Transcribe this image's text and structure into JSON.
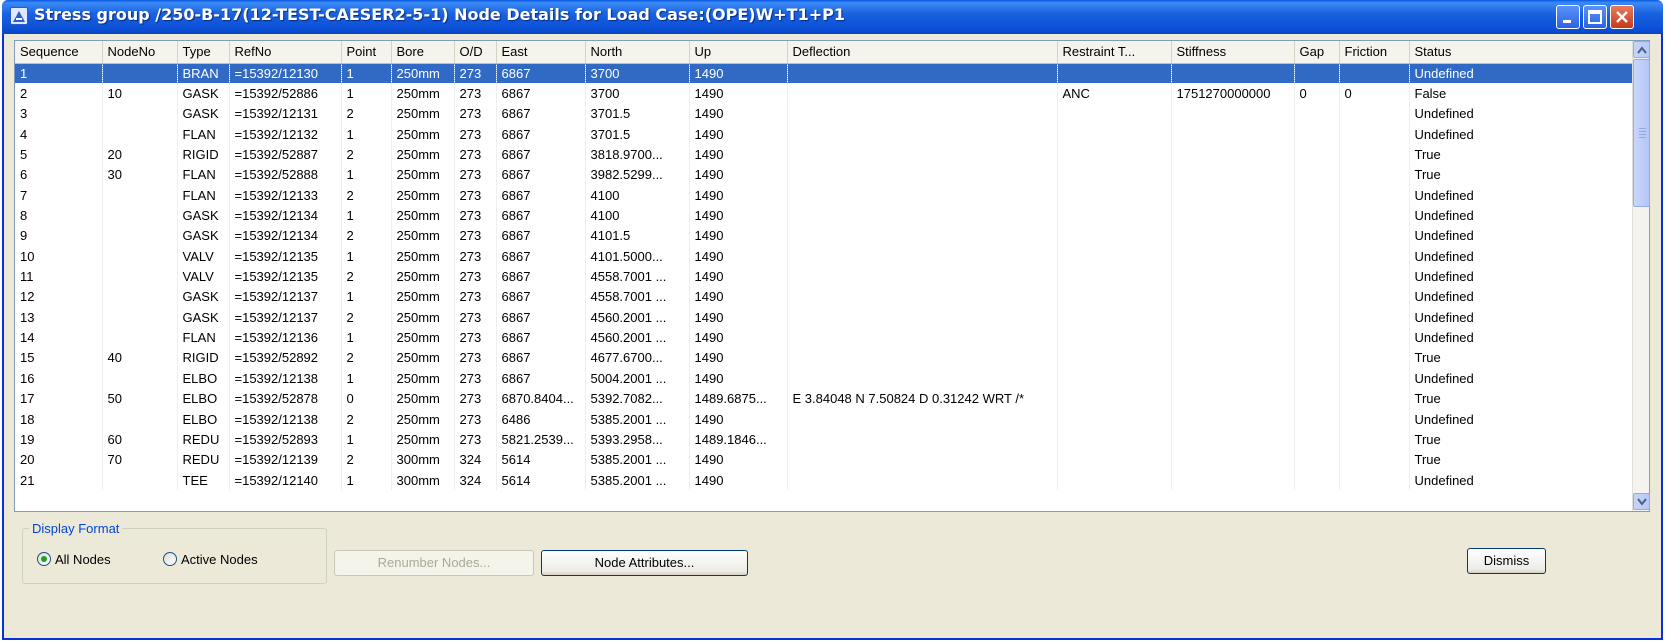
{
  "window": {
    "title": "Stress group /250-B-17(12-TEST-CAESER2-5-1) Node Details for Load Case:(OPE)W+T1+P1"
  },
  "grid": {
    "columns": [
      "Sequence",
      "NodeNo",
      "Type",
      "RefNo",
      "Point",
      "Bore",
      "O/D",
      "East",
      "North",
      "Up",
      "Deflection",
      "Restraint T...",
      "Stiffness",
      "Gap",
      "Friction",
      "Status"
    ],
    "rows": [
      [
        "1",
        "",
        "BRAN",
        "=15392/12130",
        "1",
        "250mm",
        "273",
        "6867",
        "3700",
        "1490",
        "",
        "",
        "",
        "",
        "",
        "Undefined"
      ],
      [
        "2",
        "10",
        "GASK",
        "=15392/52886",
        "1",
        "250mm",
        "273",
        "6867",
        "3700",
        "1490",
        "",
        "ANC",
        "1751270000000",
        "0",
        "0",
        "False"
      ],
      [
        "3",
        "",
        "GASK",
        "=15392/12131",
        "2",
        "250mm",
        "273",
        "6867",
        "3701.5",
        "1490",
        "",
        "",
        "",
        "",
        "",
        "Undefined"
      ],
      [
        "4",
        "",
        "FLAN",
        "=15392/12132",
        "1",
        "250mm",
        "273",
        "6867",
        "3701.5",
        "1490",
        "",
        "",
        "",
        "",
        "",
        "Undefined"
      ],
      [
        "5",
        "20",
        "RIGID",
        "=15392/52887",
        "2",
        "250mm",
        "273",
        "6867",
        "3818.9700...",
        "1490",
        "",
        "",
        "",
        "",
        "",
        "True"
      ],
      [
        "6",
        "30",
        "FLAN",
        "=15392/52888",
        "1",
        "250mm",
        "273",
        "6867",
        "3982.5299...",
        "1490",
        "",
        "",
        "",
        "",
        "",
        "True"
      ],
      [
        "7",
        "",
        "FLAN",
        "=15392/12133",
        "2",
        "250mm",
        "273",
        "6867",
        "4100",
        "1490",
        "",
        "",
        "",
        "",
        "",
        "Undefined"
      ],
      [
        "8",
        "",
        "GASK",
        "=15392/12134",
        "1",
        "250mm",
        "273",
        "6867",
        "4100",
        "1490",
        "",
        "",
        "",
        "",
        "",
        "Undefined"
      ],
      [
        "9",
        "",
        "GASK",
        "=15392/12134",
        "2",
        "250mm",
        "273",
        "6867",
        "4101.5",
        "1490",
        "",
        "",
        "",
        "",
        "",
        "Undefined"
      ],
      [
        "10",
        "",
        "VALV",
        "=15392/12135",
        "1",
        "250mm",
        "273",
        "6867",
        "4101.5000...",
        "1490",
        "",
        "",
        "",
        "",
        "",
        "Undefined"
      ],
      [
        "11",
        "",
        "VALV",
        "=15392/12135",
        "2",
        "250mm",
        "273",
        "6867",
        "4558.7001 ...",
        "1490",
        "",
        "",
        "",
        "",
        "",
        "Undefined"
      ],
      [
        "12",
        "",
        "GASK",
        "=15392/12137",
        "1",
        "250mm",
        "273",
        "6867",
        "4558.7001 ...",
        "1490",
        "",
        "",
        "",
        "",
        "",
        "Undefined"
      ],
      [
        "13",
        "",
        "GASK",
        "=15392/12137",
        "2",
        "250mm",
        "273",
        "6867",
        "4560.2001 ...",
        "1490",
        "",
        "",
        "",
        "",
        "",
        "Undefined"
      ],
      [
        "14",
        "",
        "FLAN",
        "=15392/12136",
        "1",
        "250mm",
        "273",
        "6867",
        "4560.2001 ...",
        "1490",
        "",
        "",
        "",
        "",
        "",
        "Undefined"
      ],
      [
        "15",
        "40",
        "RIGID",
        "=15392/52892",
        "2",
        "250mm",
        "273",
        "6867",
        "4677.6700...",
        "1490",
        "",
        "",
        "",
        "",
        "",
        "True"
      ],
      [
        "16",
        "",
        "ELBO",
        "=15392/12138",
        "1",
        "250mm",
        "273",
        "6867",
        "5004.2001 ...",
        "1490",
        "",
        "",
        "",
        "",
        "",
        "Undefined"
      ],
      [
        "17",
        "50",
        "ELBO",
        "=15392/52878",
        "0",
        "250mm",
        "273",
        "6870.8404...",
        "5392.7082...",
        "1489.6875...",
        "E 3.84048 N 7.50824 D 0.31242 WRT /*",
        "",
        "",
        "",
        "",
        "True"
      ],
      [
        "18",
        "",
        "ELBO",
        "=15392/12138",
        "2",
        "250mm",
        "273",
        "6486",
        "5385.2001 ...",
        "1490",
        "",
        "",
        "",
        "",
        "",
        "Undefined"
      ],
      [
        "19",
        "60",
        "REDU",
        "=15392/52893",
        "1",
        "250mm",
        "273",
        "5821.2539...",
        "5393.2958...",
        "1489.1846...",
        "",
        "",
        "",
        "",
        "",
        "True"
      ],
      [
        "20",
        "70",
        "REDU",
        "=15392/12139",
        "2",
        "300mm",
        "324",
        "5614",
        "5385.2001 ...",
        "1490",
        "",
        "",
        "",
        "",
        "",
        "True"
      ],
      [
        "21",
        "",
        "TEE",
        "=15392/12140",
        "1",
        "300mm",
        "324",
        "5614",
        "5385.2001 ...",
        "1490",
        "",
        "",
        "",
        "",
        "",
        "Undefined"
      ]
    ],
    "selected_row": 0
  },
  "display_format": {
    "label": "Display Format",
    "options": [
      {
        "label": "All Nodes",
        "selected": true
      },
      {
        "label": "Active Nodes",
        "selected": false
      }
    ]
  },
  "buttons": {
    "renumber": "Renumber Nodes...",
    "node_attributes": "Node Attributes...",
    "dismiss": "Dismiss"
  },
  "colors": {
    "selection": "#316ac5",
    "titlebar": "#0b4fd6",
    "group_label": "#0046d5"
  }
}
